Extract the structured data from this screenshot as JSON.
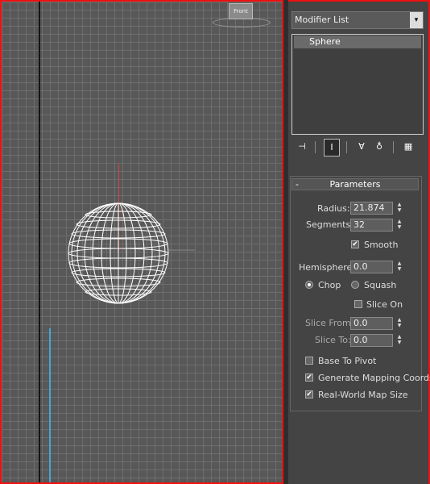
{
  "viewport": {
    "viewcube_label": "Front"
  },
  "modifier_list": {
    "label": "Modifier List",
    "arrow": "▾"
  },
  "stack": {
    "items": [
      {
        "label": "Sphere"
      }
    ]
  },
  "toolbar": {
    "icons": [
      "pin-stack-icon",
      "show-end-result-icon",
      "make-unique-icon",
      "remove-modifier-icon",
      "configure-modifier-sets-icon"
    ]
  },
  "parameters": {
    "title": "Parameters",
    "collapse": "-",
    "radius": {
      "label": "Radius:",
      "value": "21.874"
    },
    "segments": {
      "label": "Segments:",
      "value": "32"
    },
    "smooth": {
      "label": "Smooth",
      "checked": true
    },
    "hemisphere": {
      "label": "Hemisphere:",
      "value": "0.0"
    },
    "chop": {
      "label": "Chop",
      "selected": true
    },
    "squash": {
      "label": "Squash",
      "selected": false
    },
    "slice_on": {
      "label": "Slice On",
      "checked": false
    },
    "slice_from": {
      "label": "Slice From:",
      "value": "0.0"
    },
    "slice_to": {
      "label": "Slice To:",
      "value": "0.0"
    },
    "base_to_pivot": {
      "label": "Base To Pivot",
      "checked": false
    },
    "generate_mapping": {
      "label": "Generate Mapping Coords",
      "checked": true
    },
    "real_world": {
      "label": "Real-World Map Size",
      "checked": true
    }
  },
  "colors": {
    "viewport_bg": "#585858",
    "grid": "#6e6e6e",
    "selection_border": "#e11111",
    "sphere_wire": "#ffffff"
  }
}
